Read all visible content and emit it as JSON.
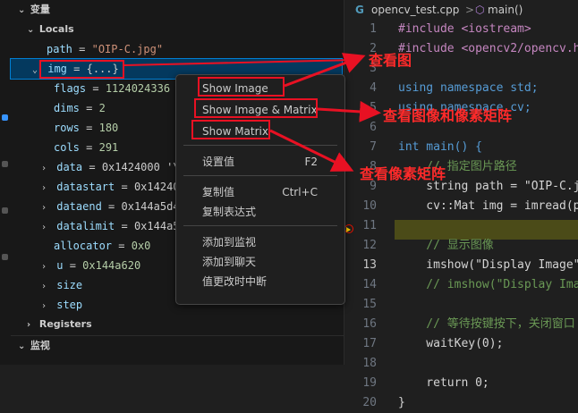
{
  "variables_panel": {
    "title": "变量",
    "locals_label": "Locals",
    "registers_label": "Registers",
    "rows": [
      {
        "name": "path",
        "value": "\"OIP-C.jpg\""
      },
      {
        "name": "img",
        "value": "{...}"
      },
      {
        "name": "flags",
        "value": "1124024336"
      },
      {
        "name": "dims",
        "value": "2"
      },
      {
        "name": "rows",
        "value": "180"
      },
      {
        "name": "cols",
        "value": "291"
      },
      {
        "name": "data",
        "value": "0x1424000 '\\"
      },
      {
        "name": "datastart",
        "value": "0x14240"
      },
      {
        "name": "dataend",
        "value": "0x144a5d4"
      },
      {
        "name": "datalimit",
        "value": "0x144a5"
      },
      {
        "name": "allocator",
        "value": "0x0"
      },
      {
        "name": "u",
        "value": "0x144a620"
      },
      {
        "name": "size",
        "value": ""
      },
      {
        "name": "step",
        "value": ""
      }
    ]
  },
  "watch_panel": {
    "title": "监视"
  },
  "editor": {
    "breadcrumb_file": "opencv_test.cpp",
    "breadcrumb_sep": ">",
    "breadcrumb_symbol": "main()",
    "line_numbers": [
      "1",
      "2",
      "3",
      "4",
      "5",
      "6",
      "7",
      "8",
      "9",
      "10",
      "11",
      "12",
      "13",
      "14",
      "15",
      "16",
      "17",
      "18",
      "19",
      "20"
    ],
    "lines": [
      "#include <iostream>",
      "#include <opencv2/opencv.h",
      "",
      "using namespace std;",
      "using namespace cv;",
      "",
      "int main() {",
      "    // 指定图片路径",
      "    string path = \"OIP-C.j",
      "    cv::Mat img = imread(p",
      "",
      "    // 显示图像",
      "    imshow(\"Display Image\"",
      "    // imshow(\"Display Ima",
      "",
      "    // 等待按键按下，关闭窗口",
      "    waitKey(0);",
      "",
      "    return 0;",
      "}"
    ]
  },
  "context_menu": {
    "items": [
      {
        "label": "Show Image",
        "shortcut": ""
      },
      {
        "label": "Show Image & Matrix",
        "shortcut": ""
      },
      {
        "label": "Show Matrix",
        "shortcut": ""
      },
      {
        "label": "设置值",
        "shortcut": "F2"
      },
      {
        "label": "复制值",
        "shortcut": "Ctrl+C"
      },
      {
        "label": "复制表达式",
        "shortcut": ""
      },
      {
        "label": "添加到监视",
        "shortcut": ""
      },
      {
        "label": "添加到聊天",
        "shortcut": ""
      },
      {
        "label": "值更改时中断",
        "shortcut": ""
      }
    ]
  },
  "annotations": {
    "view_image": "查看图",
    "view_image_pixels": "查看图像和像素矩阵",
    "view_pixels": "查看像素矩阵"
  },
  "colors": {
    "annotation_red": "#e81123",
    "accent": "#569cd6",
    "background": "#1f1f1f"
  },
  "icons": [
    "chevron-down-icon",
    "chevron-right-icon",
    "file-icon",
    "breakpoint-icon"
  ]
}
